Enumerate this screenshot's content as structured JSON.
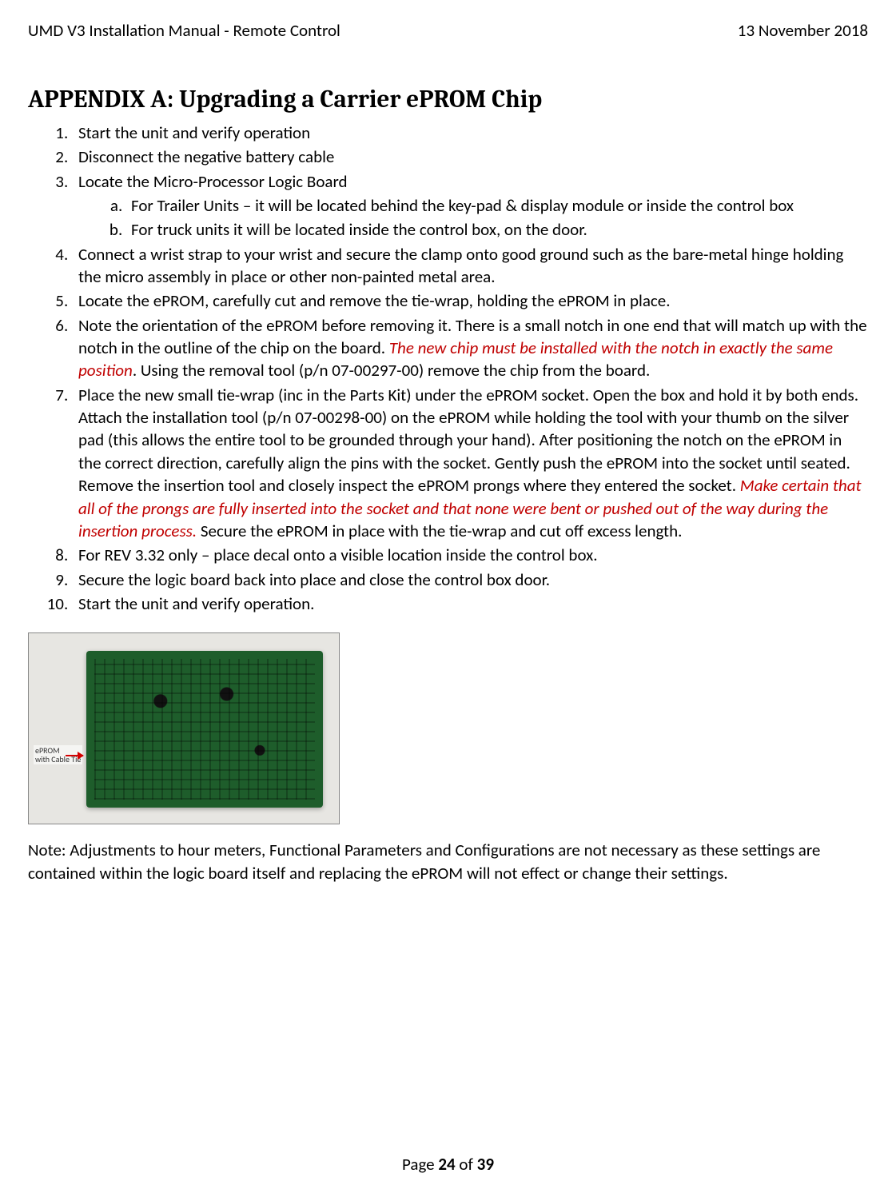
{
  "header": {
    "left": "UMD V3 Installation Manual - Remote Control",
    "right": "13 November 2018"
  },
  "title": "APPENDIX A: Upgrading a Carrier ePROM Chip",
  "steps": {
    "s1": "Start the unit and verify operation",
    "s2": "Disconnect the negative battery cable",
    "s3": "Locate the Micro-Processor Logic Board",
    "s3a": "For Trailer Units – it will be located behind the key-pad & display module or inside the control box",
    "s3b": "For truck units it will be located inside the control box, on the door.",
    "s4": "Connect a wrist strap to your wrist and secure the clamp onto good ground such as the bare-metal hinge holding the micro assembly in place or other non-painted metal area.",
    "s5": "Locate the ePROM, carefully cut and remove the tie-wrap, holding the ePROM in place.",
    "s6a": "Note the orientation of the ePROM before removing it. There is a small notch in one end that will match up with the notch in the outline of the chip on the board. ",
    "s6warn": "The new chip must be installed with the notch in exactly the same position",
    "s6b": ". Using the removal tool (p/n 07-00297-00) remove the chip from the board.",
    "s7a": "Place the new small tie-wrap (inc in the Parts Kit) under the ePROM socket. Open the box and hold it by both ends. Attach the installation tool (p/n 07-00298-00) on the ePROM while holding the tool with your thumb on the silver pad (this allows the entire tool to be grounded through your hand). After positioning the notch on the ePROM in the correct direction, carefully align the pins with the socket. Gently push the ePROM into the socket until seated. Remove the insertion tool and closely inspect the ePROM prongs where they entered the socket. ",
    "s7warn": "Make certain that all of the prongs are fully inserted into the socket and that none were bent or pushed out of the way during the insertion process.",
    "s7b": " Secure the ePROM in place with the tie-wrap and cut off excess length.",
    "s8": "For REV 3.32 only – place decal onto a visible location inside the control box.",
    "s9": "Secure the logic board back into place and close the control box door.",
    "s10": "Start the unit and verify operation."
  },
  "figure": {
    "eprom_label_line1": "ePROM",
    "eprom_label_line2": "with Cable Tie"
  },
  "note": "Note: Adjustments to hour meters, Functional Parameters and Configurations are not necessary as these settings are contained within the logic board itself and replacing the ePROM will not effect or change their settings.",
  "footer": {
    "prefix": "Page ",
    "current": "24",
    "middle": " of ",
    "total": "39"
  }
}
